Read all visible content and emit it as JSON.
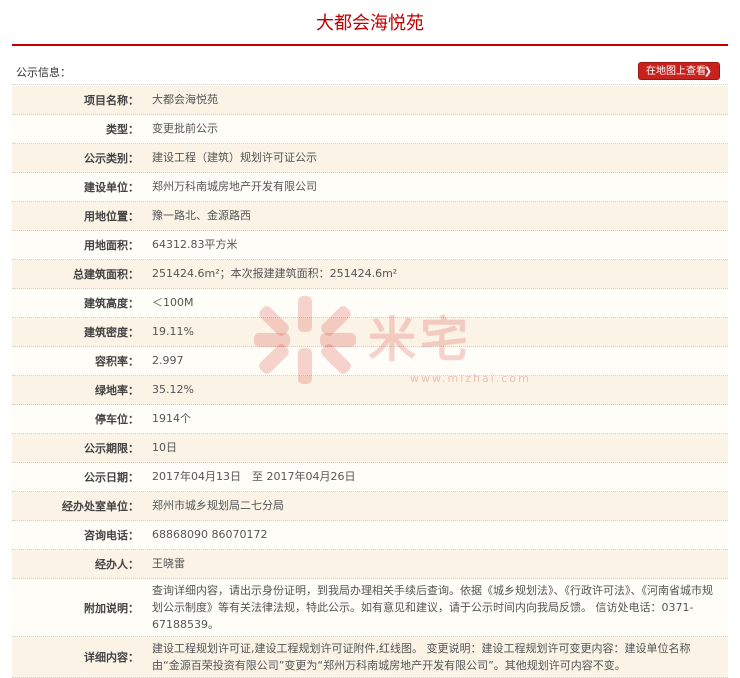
{
  "page": {
    "title": "大都会海悦苑"
  },
  "info_header": {
    "label": "公示信息：",
    "map_button": "在地图上查看",
    "map_chevron": "❯"
  },
  "fields": [
    {
      "key": "项目名称：",
      "value": "大都会海悦苑"
    },
    {
      "key": "类型：",
      "value": "变更批前公示"
    },
    {
      "key": "公示类别：",
      "value": "建设工程（建筑）规划许可证公示"
    },
    {
      "key": "建设单位：",
      "value": "郑州万科南城房地产开发有限公司"
    },
    {
      "key": "用地位置：",
      "value": "豫一路北、金源路西"
    },
    {
      "key": "用地面积：",
      "value": "64312.83平方米"
    },
    {
      "key": "总建筑面积：",
      "value": "251424.6m²；本次报建建筑面积：251424.6m²"
    },
    {
      "key": "建筑高度：",
      "value": "＜100M"
    },
    {
      "key": "建筑密度：",
      "value": "19.11%"
    },
    {
      "key": "容积率：",
      "value": "2.997"
    },
    {
      "key": "绿地率：",
      "value": "35.12%"
    },
    {
      "key": "停车位：",
      "value": "1914个"
    },
    {
      "key": "公示期限：",
      "value": "10日"
    },
    {
      "key": "公示日期：",
      "value": "2017年04月13日　至 2017年04月26日"
    },
    {
      "key": "经办处室单位：",
      "value": "郑州市城乡规划局二七分局"
    },
    {
      "key": "咨询电话：",
      "value": "68868090 86070172"
    },
    {
      "key": "经办人：",
      "value": "王晓雷"
    },
    {
      "key": "附加说明：",
      "value": "查询详细内容，请出示身份证明，到我局办理相关手续后查询。依据《城乡规划法》、《行政许可法》、《河南省城市规划公示制度》等有关法律法规，特此公示。如有意见和建议，请于公示时间内向我局反馈。 信访处电话：0371-67188539。"
    },
    {
      "key": "详细内容：",
      "value": "建设工程规划许可证,建设工程规划许可证附件,红线图。 变更说明：建设工程规划许可变更内容：建设单位名称由“金源百荣投资有限公司”变更为“郑州万科南城房地产开发有限公司”。其他规划许可内容不变。"
    }
  ],
  "watermark": {
    "text": "米宅",
    "url": "www.mizhai.com",
    "color": "#dc3c3c"
  }
}
